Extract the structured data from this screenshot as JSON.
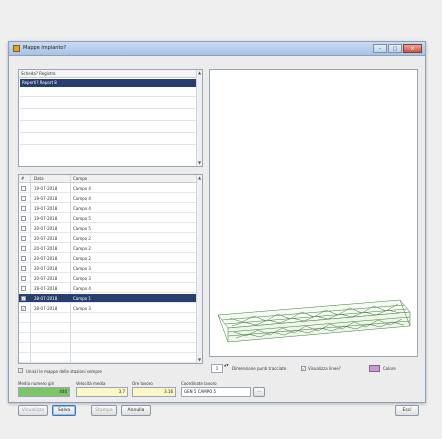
{
  "window": {
    "title": "Mappe impianto?",
    "min": "–",
    "max": "□",
    "close": "×"
  },
  "top_list": {
    "header": "Scheda? Registro",
    "selected_item": "Reperti? Report 8"
  },
  "scroll": {
    "up": "▲",
    "down": "▼"
  },
  "table": {
    "columns": [
      "#",
      "Data",
      "Campo"
    ],
    "rows": [
      {
        "checked": false,
        "date": "19-07-2018",
        "name": "Campo 4"
      },
      {
        "checked": false,
        "date": "19-07-2018",
        "name": "Campo 4"
      },
      {
        "checked": false,
        "date": "19-07-2018",
        "name": "Campo 4"
      },
      {
        "checked": false,
        "date": "19-07-2018",
        "name": "Campo 5"
      },
      {
        "checked": false,
        "date": "20-07-2018",
        "name": "Campo 5"
      },
      {
        "checked": false,
        "date": "20-07-2018",
        "name": "Campo 2"
      },
      {
        "checked": false,
        "date": "20-07-2018",
        "name": "Campo 2"
      },
      {
        "checked": false,
        "date": "20-07-2018",
        "name": "Campo 2"
      },
      {
        "checked": false,
        "date": "20-07-2018",
        "name": "Campo 3"
      },
      {
        "checked": false,
        "date": "20-07-2018",
        "name": "Campo 3"
      },
      {
        "checked": false,
        "date": "28-07-2018",
        "name": "Campo 4"
      },
      {
        "checked": true,
        "date": "28-07-2018",
        "name": "Campo 1",
        "selected": true
      },
      {
        "checked": true,
        "date": "28-07-2018",
        "name": "Campo 3"
      }
    ]
  },
  "checkbox_all": {
    "checked": true,
    "mark": "✓",
    "label": "Unisci le mappe delle stazioni sempre"
  },
  "view_controls": {
    "spin_value": "1",
    "spin_arrows": "▲▼",
    "dim_label": "Dimensione punti tracciato",
    "show_lines_checked": true,
    "show_lines_mark": "✓",
    "show_lines_label": "Visualizza linee?",
    "color_label": "Colore",
    "color_hex": "#c89ad0"
  },
  "stats": {
    "num_label": "Media numero giri",
    "num_value": "440",
    "vel_label": "Velocità media",
    "vel_value": "3.7",
    "area_label": "Ore lavoro",
    "area_value": "3.16",
    "coord_label": "Coordinate lavoro",
    "coord_value": "GEN 5 CAMPO 5",
    "browse_label": "…"
  },
  "buttons": {
    "visualizza": "Visualizza",
    "salva": "Salva",
    "stampa": "Stampa",
    "annulla": "Annulla",
    "close": "Esci"
  }
}
